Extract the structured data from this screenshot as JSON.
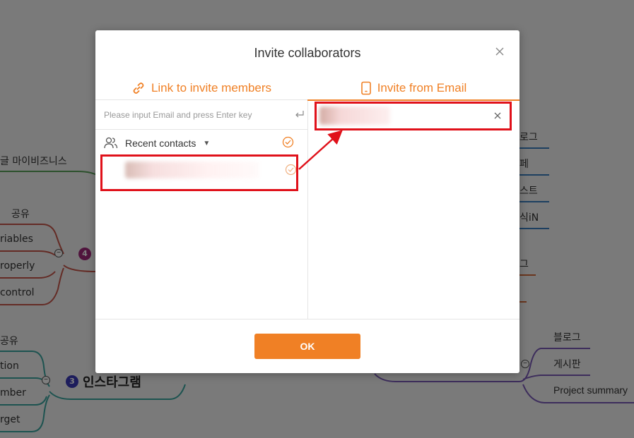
{
  "mindmap": {
    "nodes": [
      {
        "label": "글 마이비즈니스"
      },
      {
        "label": "공유"
      },
      {
        "label": "riables"
      },
      {
        "label": "roperly"
      },
      {
        "label": "control"
      },
      {
        "label": "공유"
      },
      {
        "label": "tion"
      },
      {
        "label": "mber"
      },
      {
        "label": "rget"
      },
      {
        "label": "로그"
      },
      {
        "label": "페"
      },
      {
        "label": "스트"
      },
      {
        "label": "식iN"
      },
      {
        "label": "그"
      },
      {
        "label": "블로그"
      },
      {
        "label": "게시판"
      },
      {
        "label": "Project summary"
      }
    ],
    "badges": [
      "4",
      "3"
    ],
    "central_topic": "인스타그램"
  },
  "dialog": {
    "title": "Invite collaborators",
    "tabs": [
      {
        "label": "Link to invite members",
        "icon": "link-icon"
      },
      {
        "label": "Invite from Email",
        "icon": "phone-icon"
      }
    ],
    "email_input": {
      "placeholder": "Please input Email and press Enter key",
      "value": ""
    },
    "recent_contacts_label": "Recent contacts",
    "ok_label": "OK"
  },
  "colors": {
    "accent": "#f08025",
    "annotation": "#e0111a",
    "overlay": "rgba(0,0,0,0.5)"
  }
}
